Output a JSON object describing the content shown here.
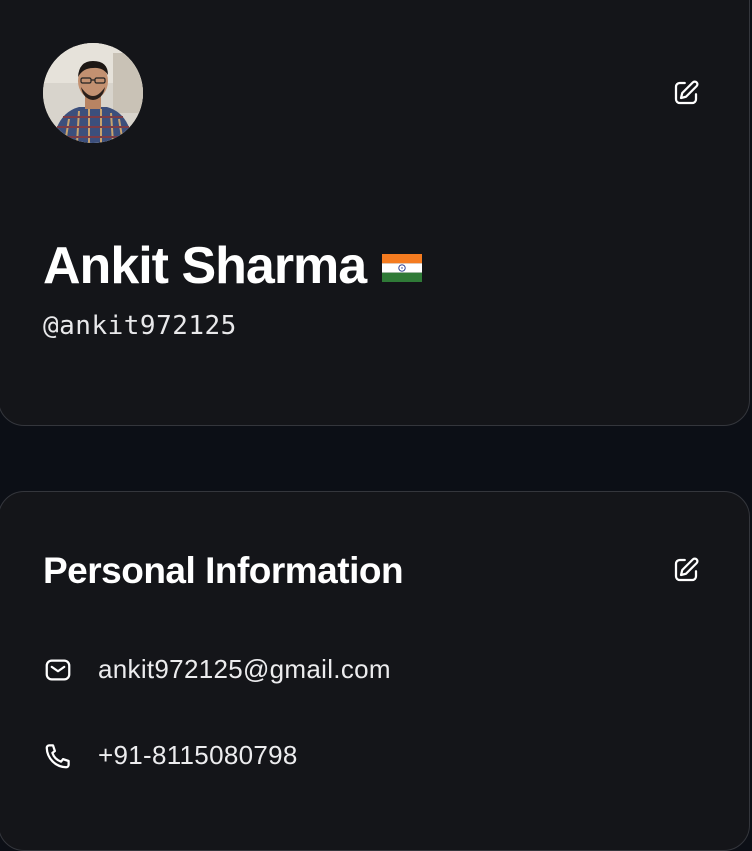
{
  "profile": {
    "name": "Ankit Sharma",
    "handle": "@ankit972125",
    "country_flag_icon": "india-flag-icon",
    "avatar_icon": "user-photo",
    "edit_icon": "edit-icon"
  },
  "personal_info": {
    "title": "Personal Information",
    "edit_icon": "edit-icon",
    "email": "ankit972125@gmail.com",
    "email_icon": "mail-icon",
    "phone": "+91-8115080798",
    "phone_icon": "phone-icon"
  },
  "colors": {
    "background": "#0c0f16",
    "card": "#141519",
    "card_border": "#34363c",
    "text": "#ffffff"
  }
}
